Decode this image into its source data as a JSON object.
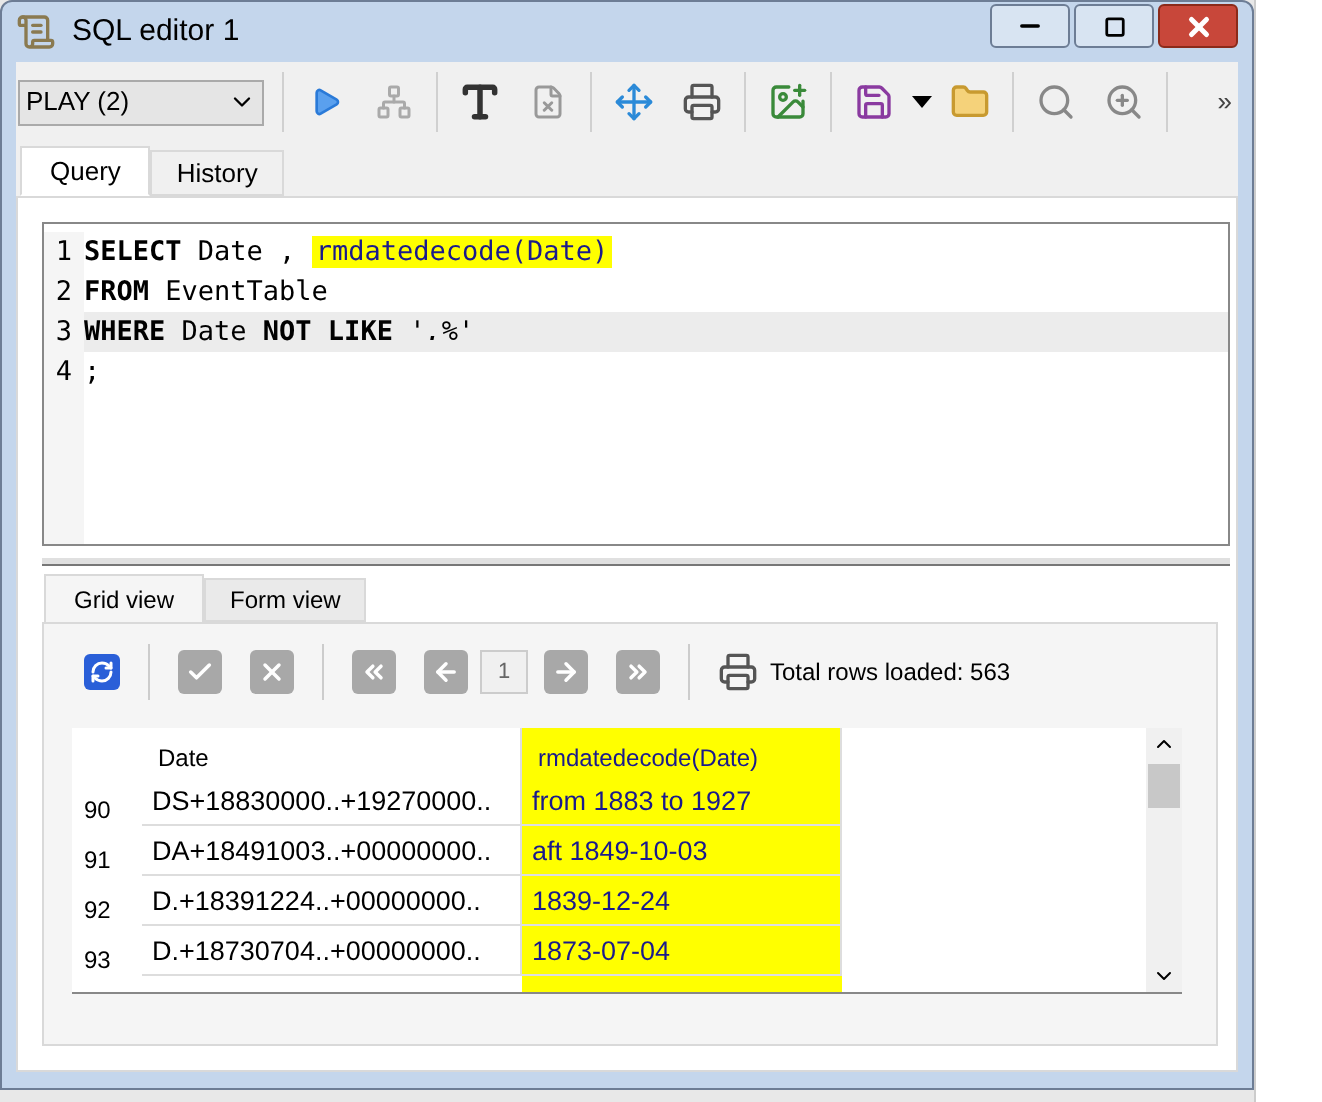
{
  "window": {
    "title": "SQL editor 1"
  },
  "toolbar": {
    "database": "PLAY (2)",
    "overflow": "»"
  },
  "tabs": [
    {
      "label": "Query",
      "selected": true
    },
    {
      "label": "History",
      "selected": false
    }
  ],
  "editor": {
    "lines": [
      {
        "number": "1",
        "current": false,
        "tokens": [
          {
            "kind": "keyword",
            "text": "SELECT"
          },
          {
            "kind": "plain",
            "text": " Date , "
          },
          {
            "kind": "highlight",
            "text": "rmdatedecode(Date)"
          }
        ]
      },
      {
        "number": "2",
        "current": false,
        "tokens": [
          {
            "kind": "keyword",
            "text": "FROM"
          },
          {
            "kind": "plain",
            "text": " EventTable"
          }
        ]
      },
      {
        "number": "3",
        "current": true,
        "tokens": [
          {
            "kind": "keyword",
            "text": "WHERE"
          },
          {
            "kind": "plain",
            "text": " Date "
          },
          {
            "kind": "keyword",
            "text": "NOT LIKE"
          },
          {
            "kind": "string",
            "text": " '.%'"
          }
        ]
      },
      {
        "number": "4",
        "current": false,
        "tokens": [
          {
            "kind": "plain",
            "text": ";"
          }
        ]
      }
    ]
  },
  "result_tabs": [
    {
      "label": "Grid view",
      "selected": true
    },
    {
      "label": "Form view",
      "selected": false
    }
  ],
  "grid_toolbar": {
    "page": "1",
    "status": "Total rows loaded: 563"
  },
  "table": {
    "columns": [
      {
        "label": "Date",
        "selected": false
      },
      {
        "label": "rmdatedecode(Date)",
        "selected": true
      }
    ],
    "rows": [
      {
        "number": "90",
        "cells": [
          "DS+18830000..+19270000..",
          "from 1883 to 1927"
        ]
      },
      {
        "number": "91",
        "cells": [
          "DA+18491003..+00000000..",
          "aft 1849-10-03"
        ]
      },
      {
        "number": "92",
        "cells": [
          "D.+18391224..+00000000..",
          "1839-12-24"
        ]
      },
      {
        "number": "93",
        "cells": [
          "D.+18730704..+00000000..",
          "1873-07-04"
        ]
      }
    ]
  }
}
